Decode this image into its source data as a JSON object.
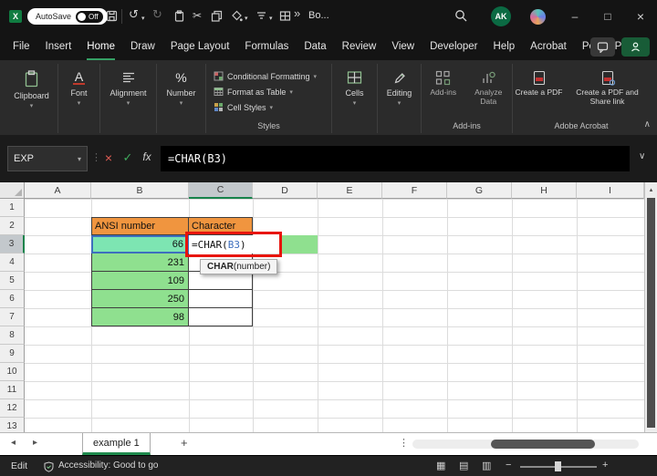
{
  "titlebar": {
    "autosave_label": "AutoSave",
    "autosave_state": "Off",
    "workbook_name": "Bo...",
    "avatar_initials": "AK"
  },
  "menubar": {
    "items": [
      "File",
      "Insert",
      "Home",
      "Draw",
      "Page Layout",
      "Formulas",
      "Data",
      "Review",
      "View",
      "Developer",
      "Help",
      "Acrobat",
      "Power Pivot"
    ],
    "active_item": "Home"
  },
  "ribbon": {
    "clipboard_label": "Clipboard",
    "font_label": "Font",
    "alignment_label": "Alignment",
    "number_label": "Number",
    "styles": {
      "label": "Styles",
      "items": [
        "Conditional Formatting",
        "Format as Table",
        "Cell Styles"
      ]
    },
    "cells_label": "Cells",
    "editing_label": "Editing",
    "addins": {
      "label": "Add-ins",
      "items": [
        "Add-ins",
        "Analyze Data"
      ]
    },
    "acrobat": {
      "label": "Adobe Acrobat",
      "items": [
        "Create a PDF",
        "Create a PDF and Share link"
      ]
    }
  },
  "formula_bar": {
    "name_box": "EXP",
    "formula": "=CHAR(B3)"
  },
  "sheet": {
    "columns": [
      "A",
      "B",
      "C",
      "D",
      "E",
      "F",
      "G",
      "H",
      "I"
    ],
    "rows": [
      "1",
      "2",
      "3",
      "4",
      "5",
      "6",
      "7",
      "8",
      "9",
      "10",
      "11",
      "12",
      "13"
    ],
    "selected_column": "C",
    "selected_row": "3",
    "table": {
      "header_b": "ANSI number",
      "header_c": "Character",
      "values_b": [
        "66",
        "231",
        "109",
        "250",
        "98"
      ]
    },
    "edit_cell": {
      "pre": "=CHAR(",
      "ref": "B3",
      "post": ")"
    },
    "tooltip": {
      "func": "CHAR",
      "args": "(number)"
    }
  },
  "sheet_tabs": {
    "active_tab": "example 1"
  },
  "status_bar": {
    "mode": "Edit",
    "accessibility": "Accessibility: Good to go"
  },
  "glyphs": {
    "excel": "X",
    "undo": "↺",
    "redo": "↻",
    "cut": "✂",
    "more": "»",
    "chevron_down": "▾",
    "chevron_up": "∧",
    "chevron_expand": "∨",
    "ellipsis_v": "⋮",
    "cancel": "×",
    "enter": "✓",
    "fx": "fx",
    "minimize": "–",
    "maximize": "□",
    "close": "×",
    "nav_left": "◂",
    "nav_right": "▸",
    "add_sheet": "+",
    "scroll_up": "▴",
    "view_normal": "▦",
    "view_layout": "▤",
    "view_break": "▥",
    "zoom_out": "−",
    "zoom_in": "+",
    "font_a": "A",
    "percent": "%"
  },
  "colors": {
    "accent_green": "#107C41",
    "orange_fill": "#F0953F",
    "green_fill": "#8FE08F",
    "ref_green_fill": "#7DE5B2",
    "ref_blue": "#3E6FBE",
    "annotation_red": "#E8150D"
  }
}
